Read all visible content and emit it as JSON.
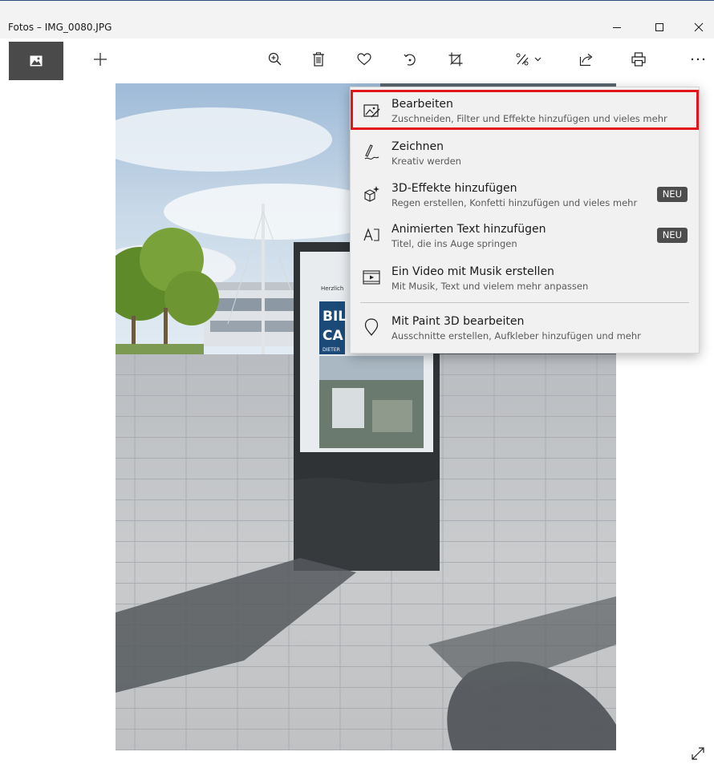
{
  "window": {
    "title": "Fotos – IMG_0080.JPG",
    "accent_color": "#2b4f7a"
  },
  "titlebar_controls": [
    {
      "name": "minimize-icon"
    },
    {
      "name": "maximize-icon"
    },
    {
      "name": "close-icon"
    }
  ],
  "toolbar": {
    "view_button_icon": "image-icon",
    "add_button_icon": "plus-icon",
    "actions": [
      {
        "name": "zoom-in-icon"
      },
      {
        "name": "delete-icon"
      },
      {
        "name": "heart-icon"
      },
      {
        "name": "rotate-icon"
      },
      {
        "name": "crop-icon"
      },
      {
        "name": "edit-and-create-icon"
      },
      {
        "name": "share-icon"
      },
      {
        "name": "print-icon"
      },
      {
        "name": "more-icon"
      }
    ]
  },
  "menu": {
    "items": [
      {
        "title": "Bearbeiten",
        "subtitle": "Zuschneiden, Filter und Effekte hinzufügen und vieles mehr",
        "icon": "edit-image-icon",
        "badge": "",
        "highlighted": true
      },
      {
        "title": "Zeichnen",
        "subtitle": "Kreativ werden",
        "icon": "draw-pen-icon",
        "badge": ""
      },
      {
        "title": "3D-Effekte hinzufügen",
        "subtitle": "Regen erstellen, Konfetti hinzufügen und vieles mehr",
        "icon": "3d-effects-icon",
        "badge": "NEU"
      },
      {
        "title": "Animierten Text hinzufügen",
        "subtitle": "Titel, die ins Auge springen",
        "icon": "animated-text-icon",
        "badge": "NEU"
      },
      {
        "title": "Ein Video mit Musik erstellen",
        "subtitle": "Mit Musik, Text und vielem mehr anpassen",
        "icon": "video-music-icon",
        "badge": ""
      },
      {
        "title": "Mit Paint 3D bearbeiten",
        "subtitle": "Ausschnitte erstellen, Aufkleber hinzufügen und mehr",
        "icon": "paint3d-icon",
        "badge": ""
      }
    ],
    "highlight_color": "#e4141b"
  },
  "photo": {
    "kiosk_text_top": "Herzlich",
    "kiosk_text_big_1": "BIL",
    "kiosk_text_big_2": "CA",
    "kiosk_text_small": "DIETER"
  },
  "expand_icon": "expand-icon"
}
